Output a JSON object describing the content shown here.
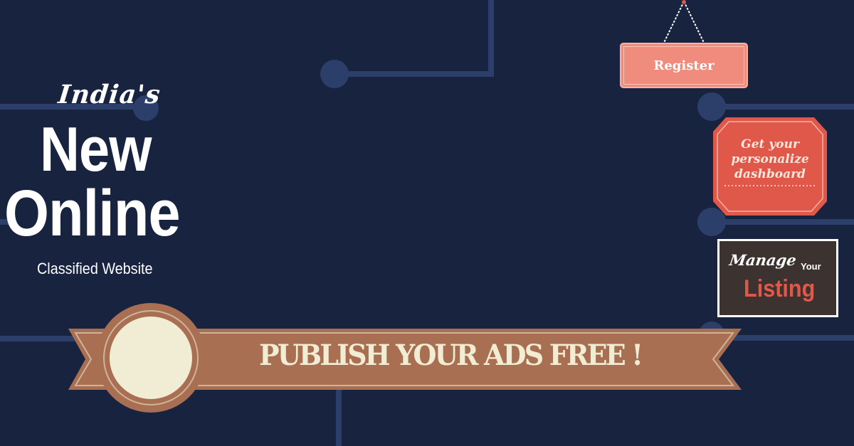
{
  "headline": {
    "line1": "India's",
    "line2": "New",
    "line3": "Online",
    "line4": "Classified Website"
  },
  "banner": {
    "text": "PUBLISH YOUR ADS FREE !"
  },
  "register": {
    "label": "Register"
  },
  "dashboard": {
    "line1": "Get your",
    "line2": "personalize",
    "line3": "dashboard"
  },
  "manage": {
    "word1": "Manage",
    "word2": "Your",
    "word3": "Listing"
  },
  "colors": {
    "background": "#18233f",
    "circuit": "#2c3f6b",
    "ribbon": "#a96f52",
    "cream": "#f1ecd4",
    "register": "#ef8c7e",
    "badge": "#e0584a",
    "listing": "#e0584a"
  }
}
